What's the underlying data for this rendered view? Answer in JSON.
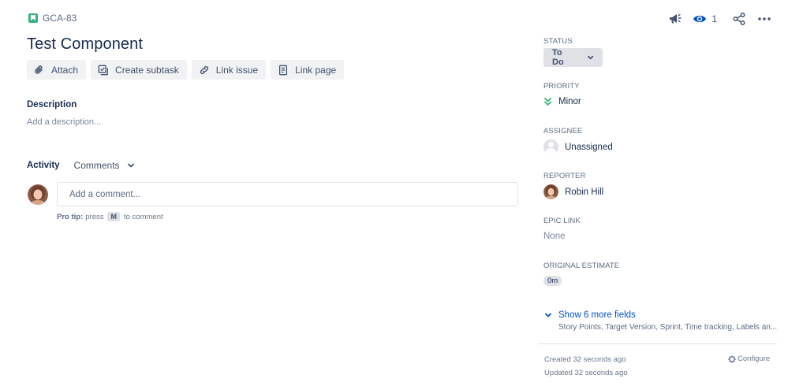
{
  "issue": {
    "key": "GCA-83",
    "title": "Test Component"
  },
  "actions": {
    "attach": "Attach",
    "create_subtask": "Create subtask",
    "link_issue": "Link issue",
    "link_page": "Link page"
  },
  "description": {
    "label": "Description",
    "placeholder": "Add a description..."
  },
  "activity": {
    "label": "Activity",
    "filter": "Comments",
    "comment_placeholder": "Add a comment...",
    "pro_tip_label": "Pro tip:",
    "pro_tip_pre": "press",
    "pro_tip_key": "M",
    "pro_tip_post": "to comment"
  },
  "header_icons": {
    "watch_count": "1"
  },
  "fields": {
    "status_label": "STATUS",
    "status_value": "To Do",
    "priority_label": "PRIORITY",
    "priority_value": "Minor",
    "assignee_label": "ASSIGNEE",
    "assignee_value": "Unassigned",
    "reporter_label": "REPORTER",
    "reporter_value": "Robin Hill",
    "epic_label": "EPIC LINK",
    "epic_value": "None",
    "estimate_label": "ORIGINAL ESTIMATE",
    "estimate_value": "0m"
  },
  "more_fields": {
    "label": "Show 6 more fields",
    "sub": "Story Points, Target Version, Sprint, Time tracking, Labels an..."
  },
  "meta": {
    "created": "Created 32 seconds ago",
    "updated": "Updated 32 seconds ago",
    "configure": "Configure"
  },
  "colors": {
    "story_icon": "#36b37e",
    "priority_minor": "#36b37e",
    "link": "#0052cc",
    "status_bg": "#dfe1e6"
  }
}
